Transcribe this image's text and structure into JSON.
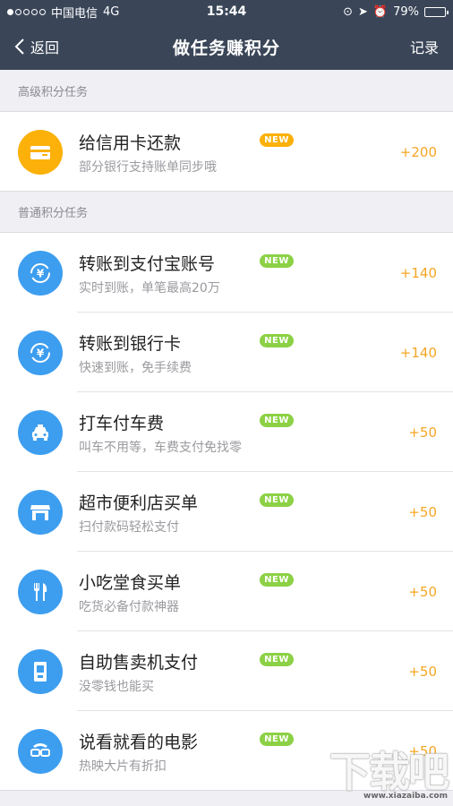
{
  "status_bar": {
    "carrier": "中国电信",
    "network": "4G",
    "time": "15:44",
    "battery": "79%",
    "battery_level": 0.79
  },
  "nav": {
    "back_label": "返回",
    "title": "做任务赚积分",
    "right_label": "记录"
  },
  "sections": [
    {
      "header": "高级积分任务",
      "items": [
        {
          "name": "给信用卡还款",
          "desc": "部分银行支持账单同步哦",
          "badge": "NEW",
          "points": "+200",
          "icon": "card-icon",
          "color": "#fbb10a"
        }
      ]
    },
    {
      "header": "普通积分任务",
      "items": [
        {
          "name": "转账到支付宝账号",
          "desc": "实时到账，单笔最高20万",
          "badge": "NEW",
          "points": "+140",
          "icon": "transfer-icon",
          "color": "#3d9ef0"
        },
        {
          "name": "转账到银行卡",
          "desc": "快速到账，免手续费",
          "badge": "NEW",
          "points": "+140",
          "icon": "transfer-icon",
          "color": "#3d9ef0"
        },
        {
          "name": "打车付车费",
          "desc": "叫车不用等，车费支付免找零",
          "badge": "NEW",
          "points": "+50",
          "icon": "taxi-icon",
          "color": "#3d9ef0"
        },
        {
          "name": "超市便利店买单",
          "desc": "扫付款码轻松支付",
          "badge": "NEW",
          "points": "+50",
          "icon": "store-icon",
          "color": "#3d9ef0"
        },
        {
          "name": "小吃堂食买单",
          "desc": "吃货必备付款神器",
          "badge": "NEW",
          "points": "+50",
          "icon": "utensils-icon",
          "color": "#3d9ef0"
        },
        {
          "name": "自助售卖机支付",
          "desc": "没零钱也能买",
          "badge": "NEW",
          "points": "+50",
          "icon": "vending-machine-icon",
          "color": "#3d9ef0"
        },
        {
          "name": "说看就看的电影",
          "desc": "热映大片有折扣",
          "badge": "NEW",
          "points": "+50",
          "icon": "movie-glasses-icon",
          "color": "#3d9ef0"
        }
      ]
    }
  ],
  "watermark": {
    "text": "下载吧",
    "url": "www.xiazaiba.com"
  }
}
